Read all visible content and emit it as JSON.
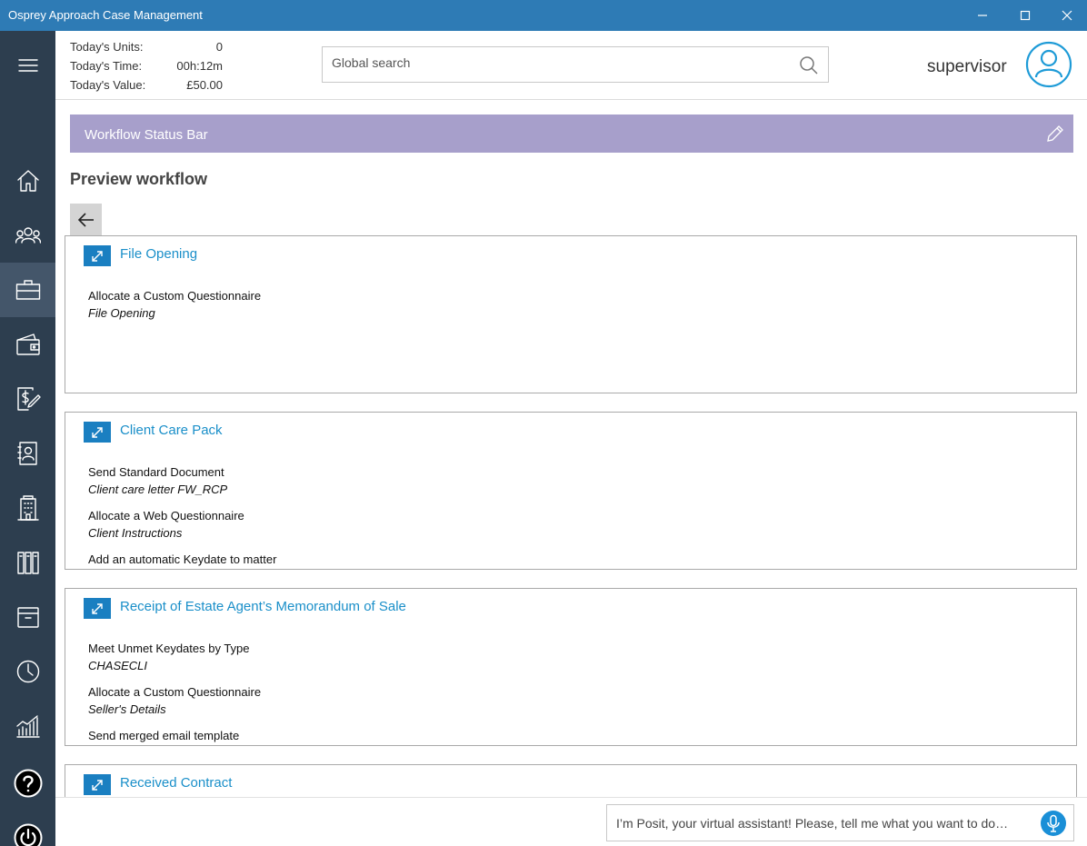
{
  "window": {
    "title": "Osprey Approach Case Management",
    "controls": [
      "minimize-icon",
      "maximize-icon",
      "close-icon"
    ]
  },
  "sidebar": {
    "menu_icon": "hamburger-menu-icon",
    "items": [
      {
        "icon": "home-icon",
        "active": false
      },
      {
        "icon": "people-icon",
        "active": false
      },
      {
        "icon": "briefcase-icon",
        "active": true
      },
      {
        "icon": "wallet-icon",
        "active": false
      },
      {
        "icon": "billing-icon",
        "active": false
      },
      {
        "icon": "contacts-icon",
        "active": false
      },
      {
        "icon": "building-icon",
        "active": false
      },
      {
        "icon": "files-icon",
        "active": false
      },
      {
        "icon": "archive-icon",
        "active": false
      },
      {
        "icon": "clock-icon",
        "active": false
      },
      {
        "icon": "chart-icon",
        "active": false
      },
      {
        "icon": "help-icon",
        "active": false
      },
      {
        "icon": "power-icon",
        "active": false
      }
    ]
  },
  "header": {
    "stats": [
      {
        "label": "Today's Units:",
        "value": "0"
      },
      {
        "label": "Today's Time:",
        "value": "00h:12m"
      },
      {
        "label": "Today's Value:",
        "value": "£50.00"
      }
    ],
    "search": {
      "placeholder": "Global search",
      "value": ""
    },
    "username": "supervisor"
  },
  "workflow_bar": {
    "title": "Workflow Status Bar",
    "color": "#a79fcb"
  },
  "preview": {
    "title": "Preview workflow"
  },
  "stages": [
    {
      "title": "File Opening",
      "actions": [
        {
          "name": "Allocate a Custom Questionnaire",
          "detail": "File Opening"
        }
      ]
    },
    {
      "title": "Client Care Pack",
      "actions": [
        {
          "name": "Send Standard Document",
          "detail": "Client care letter FW_RCP"
        },
        {
          "name": "Allocate a Web Questionnaire",
          "detail": "Client Instructions"
        },
        {
          "name": "Add an automatic Keydate to matter",
          "detail": ""
        }
      ]
    },
    {
      "title": "Receipt of Estate Agent’s Memorandum of Sale",
      "actions": [
        {
          "name": "Meet Unmet Keydates by Type",
          "detail": "CHASECLI"
        },
        {
          "name": "Allocate a Custom Questionnaire",
          "detail": "Seller's Details"
        },
        {
          "name": "Send merged email template",
          "detail": ""
        }
      ]
    },
    {
      "title": "Received Contract",
      "actions": []
    }
  ],
  "assistant": {
    "placeholder": "I’m Posit, your virtual assistant! Please, tell me what you want to do…"
  },
  "colors": {
    "titlebar": "#2e7bb5",
    "sidebar": "#2d3e4f",
    "accent": "#1a8fc9",
    "expand_button": "#1a7fc1"
  }
}
